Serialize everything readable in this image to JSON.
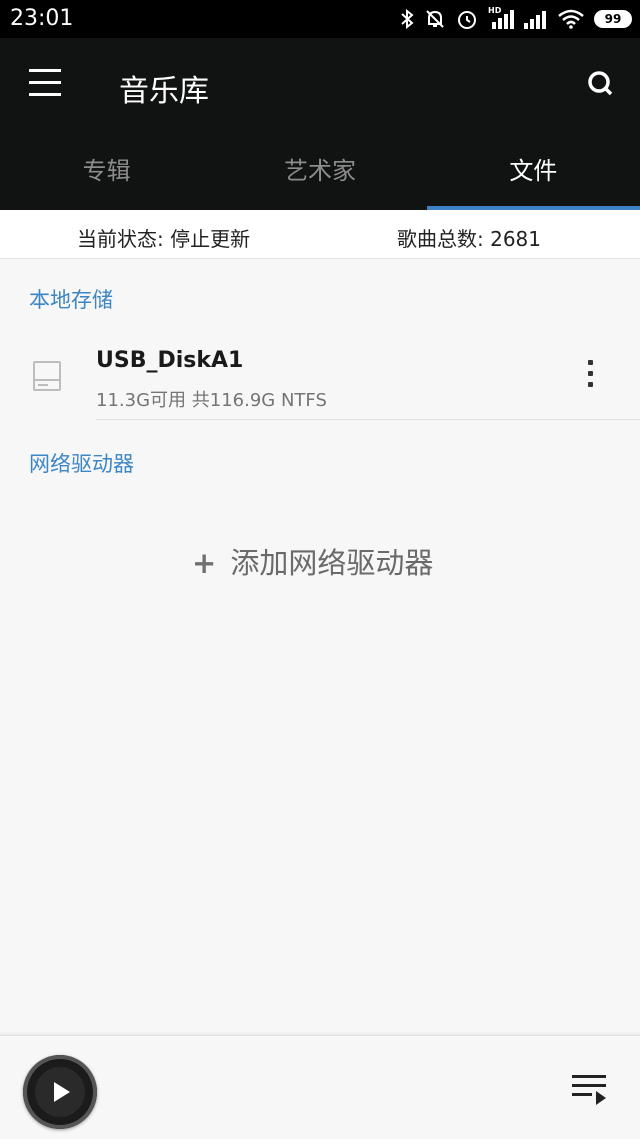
{
  "status_bar": {
    "time": "23:01",
    "hd_label": "HD",
    "battery": "99",
    "icons": [
      "bluetooth-icon",
      "mute-icon",
      "alarm-icon",
      "signal-icon",
      "signal-icon",
      "wifi-icon",
      "battery-icon"
    ]
  },
  "app_bar": {
    "title": "音乐库",
    "menu_icon": "menu-icon",
    "search_icon": "search-icon",
    "tabs": [
      {
        "label": "专辑",
        "active": false
      },
      {
        "label": "艺术家",
        "active": false
      },
      {
        "label": "文件",
        "active": true
      }
    ],
    "accent": "#3c82c8"
  },
  "stats": {
    "state": "当前状态: 停止更新",
    "song_count": "歌曲总数: 2681"
  },
  "local_storage": {
    "header": "本地存储",
    "items": [
      {
        "name": "USB_DiskA1",
        "info": "11.3G可用 共116.9G  NTFS",
        "icon": "disk-icon"
      }
    ]
  },
  "network_drives": {
    "header": "网络驱动器",
    "add_plus": "+",
    "add_label": "添加网络驱动器"
  },
  "player": {
    "play_icon": "play-icon",
    "queue_icon": "queue-icon"
  }
}
